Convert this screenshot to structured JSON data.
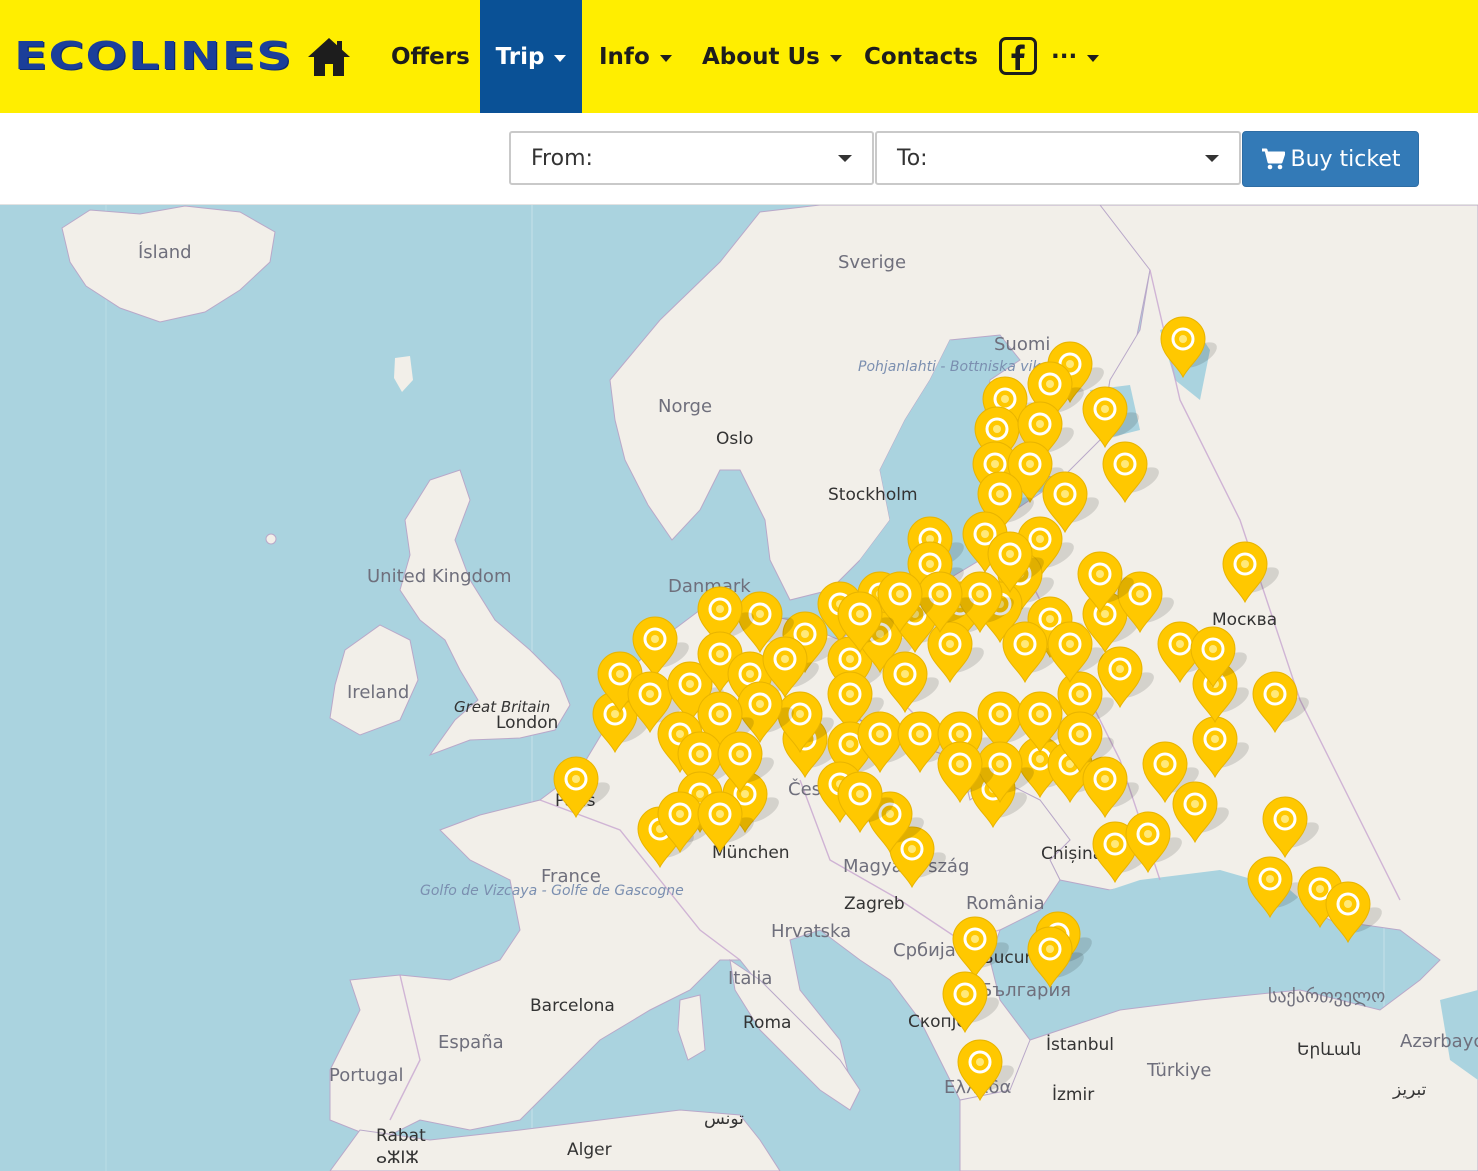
{
  "brand": {
    "logo_text": "ECOLINES",
    "logo_color": "#1b3f9a",
    "header_color": "#ffee00"
  },
  "nav": {
    "home_icon": "home-icon",
    "items": [
      {
        "label": "Offers",
        "dropdown": false,
        "active": false
      },
      {
        "label": "Trip",
        "dropdown": true,
        "active": true
      },
      {
        "label": "Info",
        "dropdown": true,
        "active": false
      },
      {
        "label": "About Us",
        "dropdown": true,
        "active": false
      },
      {
        "label": "Contacts",
        "dropdown": false,
        "active": false
      }
    ],
    "social_icon": "facebook-icon",
    "more_label": "···",
    "active_color": "#0a5196"
  },
  "search": {
    "from_label": "From:",
    "to_label": "To:",
    "buy_label": "Buy ticket",
    "buy_icon": "shopping-cart-icon",
    "buy_color": "#337ab7"
  },
  "map": {
    "water_color": "#aad3df",
    "land_color": "#f2efe9",
    "marker_color": "#ffc800",
    "labels": {
      "island": "Ísland",
      "sverige": "Sverige",
      "suomi": "Suomi",
      "gulf": "Pohjanlahti - Bottniska viken",
      "norge": "Norge",
      "oslo": "Oslo",
      "stockholm": "Stockholm",
      "uk": "United Kingdom",
      "danmark": "Danmark",
      "ireland": "Ireland",
      "gb": "Great Britain",
      "london": "London",
      "paris": "Paris",
      "france": "France",
      "biscay": "Golfo de Vizcaya - Golfe de Gascogne",
      "munchen": "München",
      "ceska": "Česko",
      "magyar": "Magyarország",
      "zagreb": "Zagreb",
      "hrvatska": "Hrvatska",
      "romania": "România",
      "chisinau": "Chișinău",
      "moskva": "Москва",
      "srbija": "Србија",
      "bucuresti": "București",
      "bulgaria": "България",
      "skopje": "Скопје",
      "italia": "Italia",
      "roma": "Roma",
      "barcelona": "Barcelona",
      "espana": "España",
      "portugal": "Portugal",
      "rabat": "Rabat",
      "rabat2": "ⴰⵣⵏⵣ",
      "tunis": "تونس",
      "alger": "Alger",
      "istanbul": "İstanbul",
      "izmir": "İzmir",
      "turkiye": "Türkiye",
      "ellada": "Ελλάδα",
      "sakartvelo": "საქართველო",
      "yerevan": "Երևան",
      "azerbaijan": "Azərbaycan",
      "tabriz": "تبریز"
    }
  }
}
